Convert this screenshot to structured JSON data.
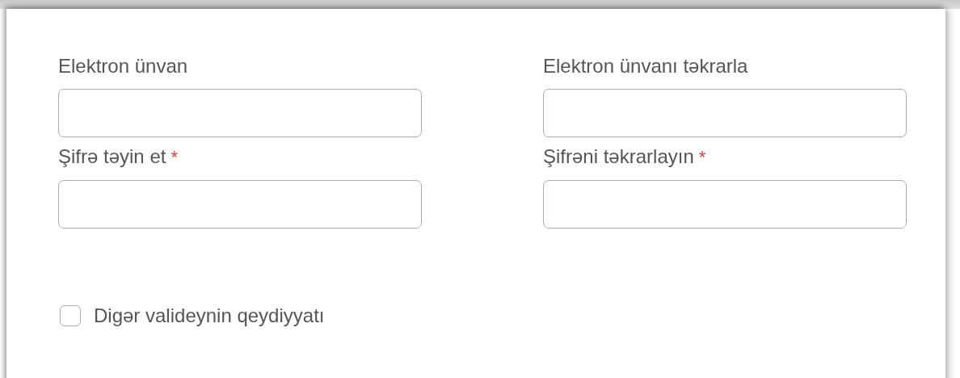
{
  "fields": [
    {
      "label": "Elektron ünvan"
    },
    {
      "label": "Elektron ünvanı təkrarla"
    },
    {
      "label": "Şifrə təyin et",
      "required_mark": "*"
    },
    {
      "label": "Şifrəni təkrarlayın",
      "required_mark": "*"
    }
  ],
  "checkbox": {
    "label": "Digər valideynin qeydiyyatı",
    "checked": false
  }
}
